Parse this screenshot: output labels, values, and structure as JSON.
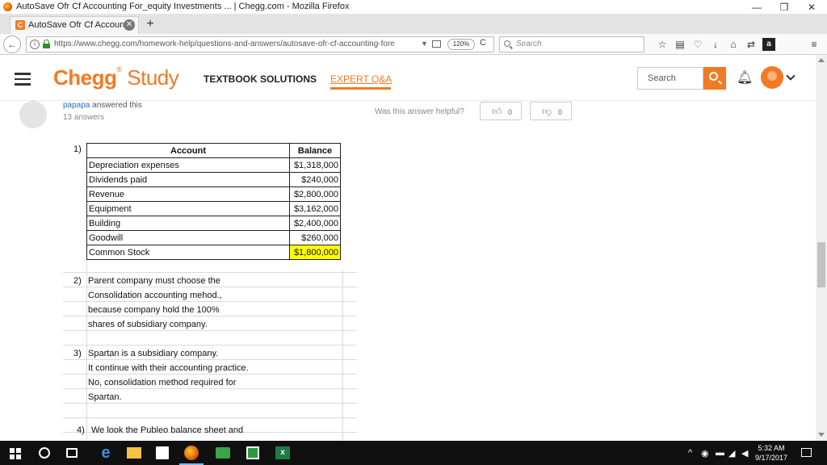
{
  "window": {
    "title": "AutoSave Ofr Cf Accounting For_equity Investments ... | Chegg.com - Mozilla Firefox",
    "minimize": "—",
    "restore": "❐",
    "close": "✕"
  },
  "tabs": [
    {
      "favicon": "C",
      "label": "AutoSave Ofr Cf Accounting",
      "close": "✕"
    }
  ],
  "newtab": "+",
  "navbar": {
    "back": "←",
    "info": "i",
    "url": "https://www.chegg.com/homework-help/questions-and-answers/autosave-ofr-cf-accounting-fore",
    "dropdown": "▼",
    "zoom": "120%",
    "reload": "C",
    "search_placeholder": "Search",
    "icons": [
      "star-icon",
      "reading-list-icon",
      "pocket-icon",
      "download-icon",
      "home-icon",
      "sync-icon",
      "amazon-icon",
      "menu-icon"
    ]
  },
  "chegg": {
    "logo_bold": "Chegg",
    "logo_light": "Study",
    "nav_textbook": "TEXTBOOK SOLUTIONS",
    "nav_expert": "EXPERT Q&A",
    "search_placeholder": "Search"
  },
  "answer": {
    "username": "papapa",
    "answered": " answered this",
    "answers_count": "13 answers",
    "helpful_prompt": "Was this answer helpful?",
    "thumbs_up_count": "0",
    "thumbs_down_count": "0"
  },
  "sheet": {
    "item1_label": "1)",
    "headers": {
      "account": "Account",
      "balance": "Balance"
    },
    "rows": [
      {
        "account": "Depreciation expenses",
        "balance": "$1,318,000"
      },
      {
        "account": "Dividends paid",
        "balance": "$240,000"
      },
      {
        "account": "Revenue",
        "balance": "$2,800,000"
      },
      {
        "account": "Equipment",
        "balance": "$3,162,000"
      },
      {
        "account": "Building",
        "balance": "$2,400,000"
      },
      {
        "account": "Goodwill",
        "balance": "$260,000"
      },
      {
        "account": "Common Stock",
        "balance": "$1,800,000",
        "highlight": true
      }
    ],
    "highlight_color": "#ffff00",
    "item2_label": "2)",
    "item2_lines": [
      "Parent company must choose the",
      "Consolidation accounting mehod.,",
      "because company hold the 100%",
      "shares of subsidiary company."
    ],
    "item3_label": "3)",
    "item3_lines": [
      "Spartan is a subsidiary company.",
      "It continue with their accounting practice.",
      "No, consolidation method required for",
      "Spartan."
    ],
    "item4_label": "4)",
    "item4_lines": [
      "We look the Publeo balance sheet and"
    ]
  },
  "taskbar": {
    "apps": [
      "windows-start-icon",
      "cortana-icon",
      "task-view-icon",
      "edge-icon",
      "file-explorer-icon",
      "store-icon",
      "firefox-icon",
      "app-icon",
      "app2-icon",
      "excel-icon"
    ],
    "excel_label": "x",
    "tray_chevron": "^",
    "time": "5:32 AM",
    "date": "9/17/2017"
  },
  "colors": {
    "brand": "#f27a24",
    "link": "#2a6ebb"
  }
}
